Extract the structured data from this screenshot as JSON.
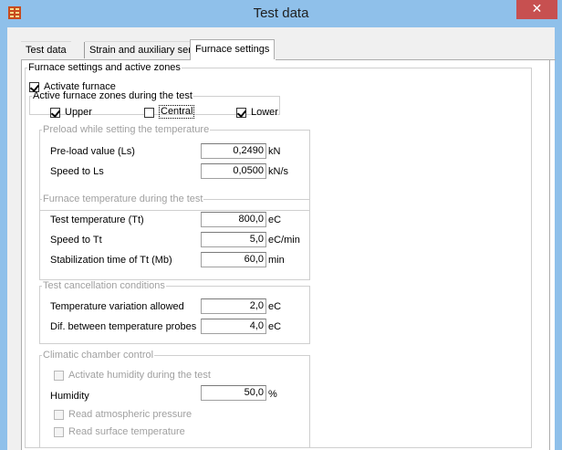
{
  "window": {
    "title": "Test data",
    "close_glyph": "✕",
    "icon": "app-grid-icon"
  },
  "tabs": [
    {
      "label": "Test data"
    },
    {
      "label": "Strain and auxiliary sensors"
    },
    {
      "label": "Furnace settings"
    }
  ],
  "furnace": {
    "group_title": "Furnace settings and active zones",
    "activate_label": "Activate furnace",
    "activate_checked": true,
    "zones_title": "Active furnace zones during the test",
    "zones": [
      {
        "label": "Upper",
        "checked": true
      },
      {
        "label": "Central",
        "checked": false
      },
      {
        "label": "Lower",
        "checked": true
      }
    ]
  },
  "preload": {
    "title": "Preload while setting the temperature",
    "rows": [
      {
        "label": "Pre-load value (Ls)",
        "value": "0,2490",
        "unit": "kN"
      },
      {
        "label": "Speed to Ls",
        "value": "0,0500",
        "unit": "kN/s"
      }
    ]
  },
  "temperature": {
    "title": "Furnace temperature during the test",
    "rows": [
      {
        "label": "Test temperature (Tt)",
        "value": "800,0",
        "unit": "eC"
      },
      {
        "label": "Speed to Tt",
        "value": "5,0",
        "unit": "eC/min"
      },
      {
        "label": "Stabilization time of Tt (Mb)",
        "value": "60,0",
        "unit": "min"
      }
    ]
  },
  "cancellation": {
    "title": "Test cancellation conditions",
    "rows": [
      {
        "label": "Temperature variation allowed",
        "value": "2,0",
        "unit": "eC"
      },
      {
        "label": "Dif. between temperature probes",
        "value": "4,0",
        "unit": "eC"
      }
    ]
  },
  "climatic": {
    "title": "Climatic chamber control",
    "humidity_activate_label": "Activate humidity during the test",
    "humidity_label": "Humidity",
    "humidity_value": "50,0",
    "humidity_unit": "%",
    "pressure_label": "Read atmospheric pressure",
    "surface_label": "Read surface temperature"
  },
  "colors": {
    "titlebar": "#8fc0ea",
    "close": "#c75050",
    "disabled_text": "#a0a0a0"
  }
}
